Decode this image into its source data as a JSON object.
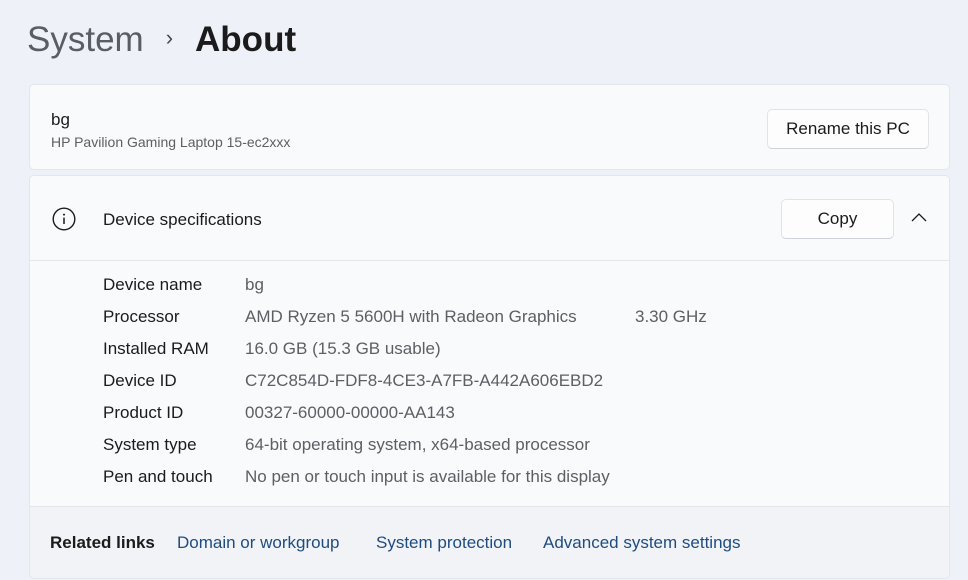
{
  "breadcrumb": {
    "parent": "System",
    "separator": "›",
    "current": "About"
  },
  "pc": {
    "name": "bg",
    "model": "HP Pavilion Gaming Laptop 15-ec2xxx",
    "rename_label": "Rename this PC"
  },
  "device_specs": {
    "icon": "info-icon",
    "title": "Device specifications",
    "copy_label": "Copy",
    "expanded": true,
    "rows": [
      {
        "label": "Device name",
        "value": "bg",
        "extra": ""
      },
      {
        "label": "Processor",
        "value": "AMD Ryzen 5 5600H with Radeon Graphics",
        "extra": "3.30 GHz"
      },
      {
        "label": "Installed RAM",
        "value": "16.0 GB (15.3 GB usable)",
        "extra": ""
      },
      {
        "label": "Device ID",
        "value": "C72C854D-FDF8-4CE3-A7FB-A442A606EBD2",
        "extra": ""
      },
      {
        "label": "Product ID",
        "value": "00327-60000-00000-AA143",
        "extra": ""
      },
      {
        "label": "System type",
        "value": "64-bit operating system, x64-based processor",
        "extra": ""
      },
      {
        "label": "Pen and touch",
        "value": "No pen or touch input is available for this display",
        "extra": ""
      }
    ]
  },
  "related_links": {
    "label": "Related links",
    "links": [
      {
        "label": "Domain or workgroup"
      },
      {
        "label": "System protection"
      },
      {
        "label": "Advanced system settings"
      }
    ]
  },
  "colors": {
    "background": "#eef2f8",
    "card": "#f9fafc",
    "link": "#1f4c80",
    "secondary_text": "#5c5f63"
  }
}
